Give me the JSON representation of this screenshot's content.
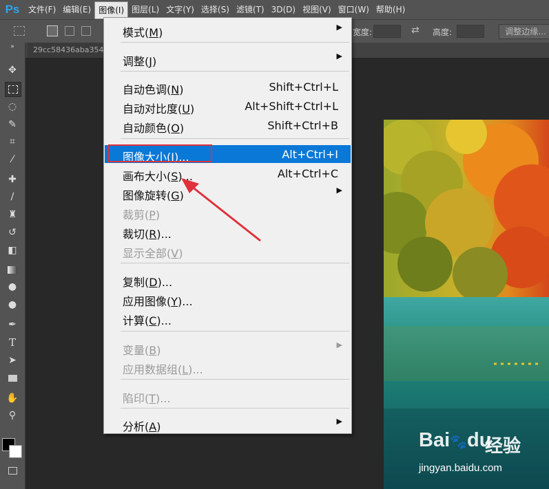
{
  "app": {
    "logo": "Ps"
  },
  "menubar": {
    "items": [
      "文件(F)",
      "编辑(E)",
      "图像(I)",
      "图层(L)",
      "文字(Y)",
      "选择(S)",
      "滤镜(T)",
      "3D(D)",
      "视图(V)",
      "窗口(W)",
      "帮助(H)"
    ],
    "active": "图像(I)"
  },
  "options": {
    "width_label": "宽度:",
    "height_label": "高度:",
    "adjust_edge": "调整边缘..."
  },
  "document": {
    "tab_title": "29cc58436aba354"
  },
  "image_menu": {
    "items": [
      {
        "label": "模式(",
        "key": "M",
        "suffix": ")",
        "shortcut": "",
        "submenu": true,
        "disabled": false
      },
      {
        "label": "调整(",
        "key": "J",
        "suffix": ")",
        "shortcut": "",
        "submenu": true,
        "disabled": false
      },
      {
        "label": "自动色调(",
        "key": "N",
        "suffix": ")",
        "shortcut": "Shift+Ctrl+L",
        "submenu": false,
        "disabled": false
      },
      {
        "label": "自动对比度(",
        "key": "U",
        "suffix": ")",
        "shortcut": "Alt+Shift+Ctrl+L",
        "submenu": false,
        "disabled": false
      },
      {
        "label": "自动颜色(",
        "key": "O",
        "suffix": ")",
        "shortcut": "Shift+Ctrl+B",
        "submenu": false,
        "disabled": false
      },
      {
        "label": "图像大小(",
        "key": "I",
        "suffix": ")...",
        "shortcut": "Alt+Ctrl+I",
        "submenu": false,
        "disabled": false,
        "highlighted": true
      },
      {
        "label": "画布大小(",
        "key": "S",
        "suffix": ")...",
        "shortcut": "Alt+Ctrl+C",
        "submenu": false,
        "disabled": false
      },
      {
        "label": "图像旋转(",
        "key": "G",
        "suffix": ")",
        "shortcut": "",
        "submenu": true,
        "disabled": false
      },
      {
        "label": "裁剪(",
        "key": "P",
        "suffix": ")",
        "shortcut": "",
        "submenu": false,
        "disabled": true
      },
      {
        "label": "裁切(",
        "key": "R",
        "suffix": ")...",
        "shortcut": "",
        "submenu": false,
        "disabled": false
      },
      {
        "label": "显示全部(",
        "key": "V",
        "suffix": ")",
        "shortcut": "",
        "submenu": false,
        "disabled": true
      },
      {
        "label": "复制(",
        "key": "D",
        "suffix": ")...",
        "shortcut": "",
        "submenu": false,
        "disabled": false
      },
      {
        "label": "应用图像(",
        "key": "Y",
        "suffix": ")...",
        "shortcut": "",
        "submenu": false,
        "disabled": false
      },
      {
        "label": "计算(",
        "key": "C",
        "suffix": ")...",
        "shortcut": "",
        "submenu": false,
        "disabled": false
      },
      {
        "label": "变量(",
        "key": "B",
        "suffix": ")",
        "shortcut": "",
        "submenu": true,
        "disabled": true
      },
      {
        "label": "应用数据组(",
        "key": "L",
        "suffix": ")...",
        "shortcut": "",
        "submenu": false,
        "disabled": true
      },
      {
        "label": "陷印(",
        "key": "T",
        "suffix": ")...",
        "shortcut": "",
        "submenu": false,
        "disabled": true
      },
      {
        "label": "分析(",
        "key": "A",
        "suffix": ")",
        "shortcut": "",
        "submenu": true,
        "disabled": false
      }
    ]
  },
  "watermark": {
    "logo": "Bai",
    "logo2": "du",
    "product": "经验",
    "url": "jingyan.baidu.com"
  },
  "colors": {
    "highlight": "#0a78d7",
    "annotation": "#e0303a",
    "ps_blue": "#2fa3f0"
  },
  "icons": [
    "move-icon",
    "marquee-icon",
    "lasso-icon",
    "quick-select-icon",
    "crop-icon",
    "eyedropper-icon",
    "healing-icon",
    "brush-icon",
    "stamp-icon",
    "history-brush-icon",
    "eraser-icon",
    "gradient-icon",
    "blur-icon",
    "dodge-icon",
    "pen-icon",
    "type-icon",
    "path-select-icon",
    "rectangle-icon",
    "hand-icon",
    "zoom-icon"
  ]
}
